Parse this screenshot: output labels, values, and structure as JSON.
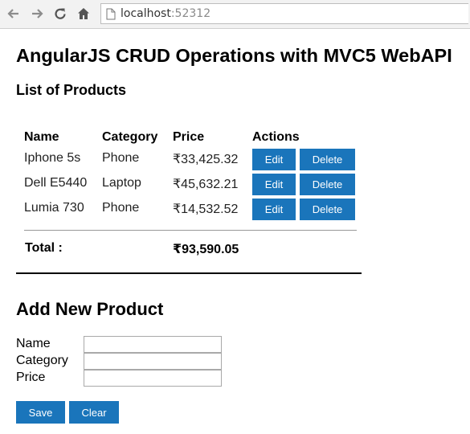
{
  "browser": {
    "url_host": "localhost",
    "url_port": ":52312"
  },
  "page": {
    "title": "AngularJS CRUD Operations with MVC5 WebAPI",
    "list_heading": "List of Products",
    "columns": [
      "Name",
      "Category",
      "Price",
      "Actions"
    ],
    "products": [
      {
        "name": "Iphone 5s",
        "category": "Phone",
        "price": "₹33,425.32"
      },
      {
        "name": "Dell E5440",
        "category": "Laptop",
        "price": "₹45,632.21"
      },
      {
        "name": "Lumia 730",
        "category": "Phone",
        "price": "₹14,532.52"
      }
    ],
    "edit_label": "Edit",
    "delete_label": "Delete",
    "total_label": "Total :",
    "total_value": "₹93,590.05",
    "add_heading": "Add New Product",
    "form": {
      "name_label": "Name",
      "category_label": "Category",
      "price_label": "Price",
      "name_value": "",
      "category_value": "",
      "price_value": ""
    },
    "save_label": "Save",
    "clear_label": "Clear"
  },
  "colors": {
    "button": "#1a75bb",
    "button_text": "#ffffff",
    "toolbar": "#f2f2f2"
  }
}
